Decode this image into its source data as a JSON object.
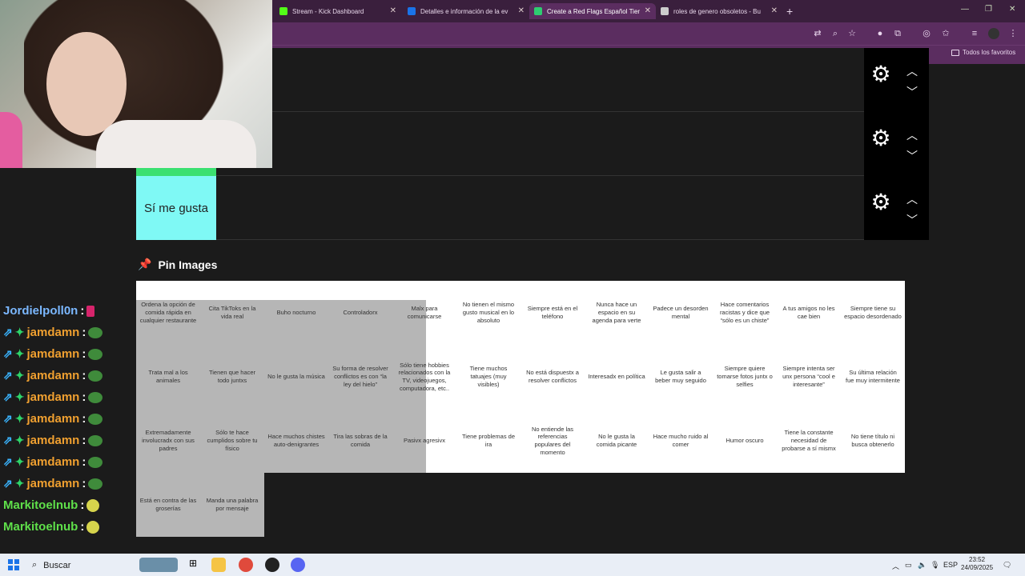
{
  "browser": {
    "tabs": [
      {
        "title": "Stream - Kick Dashboard",
        "fav_color": "#53fc18"
      },
      {
        "title": "Detalles e información de la ev",
        "fav_color": "#1a73e8"
      },
      {
        "title": "Create a Red Flags Español Tier",
        "fav_color": "#2ecc71"
      },
      {
        "title": "roles de genero obsoletos - Bu",
        "fav_color": "#cccccc"
      }
    ],
    "new_tab": "+",
    "bookmarks_folder": "Todos los favoritos"
  },
  "tiers": [
    {
      "label": "",
      "color": "#1b1b1b"
    },
    {
      "label": "",
      "color": "#1b1b1b"
    },
    {
      "label": "Sí me gusta",
      "color": "#7ff9f5"
    }
  ],
  "pin_images": {
    "header": "Pin Images",
    "row1": [
      "Ordena la opción de comida rápida en cualquier restaurante",
      "Cita TikToks en la vida real",
      "Buho nocturno",
      "Controladorx",
      "Malx para comunicarse",
      "No tienen el mismo gusto musical en lo absoluto",
      "Siempre está en el teléfono",
      "Nunca hace un espacio en su agenda para verte",
      "Padece un desorden mental",
      "Hace comentarios racistas y dice que “sólo es un chiste”",
      "A tus amigos no les cae bien",
      "Siempre tiene su espacio desordenado"
    ],
    "row2": [
      "Trata mal a los animales",
      "Tienen que hacer todo juntxs",
      "No le gusta la música",
      "Su forma de resolver conflictos es con “la ley del hielo”",
      "Sólo tiene hobbies relacionados con la TV, videojuegos, computadora, etc..",
      "Tiene muchos tatuajes (muy visibles)",
      "No está dispuestx a resolver conflictos",
      "Interesadx en política",
      "Le gusta salir a beber muy seguido",
      "Siempre quiere tomarse fotos juntx o selfies",
      "Siempre intenta ser unx persona “cool e interesante”",
      "Su última relación fue muy intermitente"
    ],
    "row3": [
      "Extremadamente involucradx con sus padres",
      "Sólo te hace cumplidos sobre tu físico",
      "Hace muchos chistes auto-denigrantes",
      "Tira las sobras de la comida",
      "Pasivx agresivx",
      "Tiene problemas de ira",
      "No entiende las referencias populares del momento",
      "No le gusta la comida picante",
      "Hace mucho ruido al comer",
      "Humor oscuro",
      "Tiene la constante necesidad de probarse a sí mismx",
      "No tiene título ni busca obtenerlo"
    ],
    "row4": [
      "Está en contra de las groserías",
      "Manda una palabra por mensaje"
    ]
  },
  "chat": [
    {
      "user": "Jordielpoll0n",
      "color": "#7bb8ff",
      "badges": false,
      "emote": "pink"
    },
    {
      "user": "jamdamn",
      "color": "#f0a030",
      "badges": true,
      "emote": "pepe"
    },
    {
      "user": "jamdamn",
      "color": "#f0a030",
      "badges": true,
      "emote": "pepe"
    },
    {
      "user": "jamdamn",
      "color": "#f0a030",
      "badges": true,
      "emote": "pepe"
    },
    {
      "user": "jamdamn",
      "color": "#f0a030",
      "badges": true,
      "emote": "pepe"
    },
    {
      "user": "jamdamn",
      "color": "#f0a030",
      "badges": true,
      "emote": "pepe"
    },
    {
      "user": "jamdamn",
      "color": "#f0a030",
      "badges": true,
      "emote": "pepe"
    },
    {
      "user": "jamdamn",
      "color": "#f0a030",
      "badges": true,
      "emote": "pepe"
    },
    {
      "user": "jamdamn",
      "color": "#f0a030",
      "badges": true,
      "emote": "pepe"
    },
    {
      "user": "Markitoelnub",
      "color": "#5fe04a",
      "badges": false,
      "emote": "yellow"
    },
    {
      "user": "Markitoelnub",
      "color": "#5fe04a",
      "badges": false,
      "emote": "yellow"
    }
  ],
  "taskbar": {
    "search": "Buscar",
    "lang": "ESP",
    "time": "23:52",
    "date": "24/09/2025"
  }
}
